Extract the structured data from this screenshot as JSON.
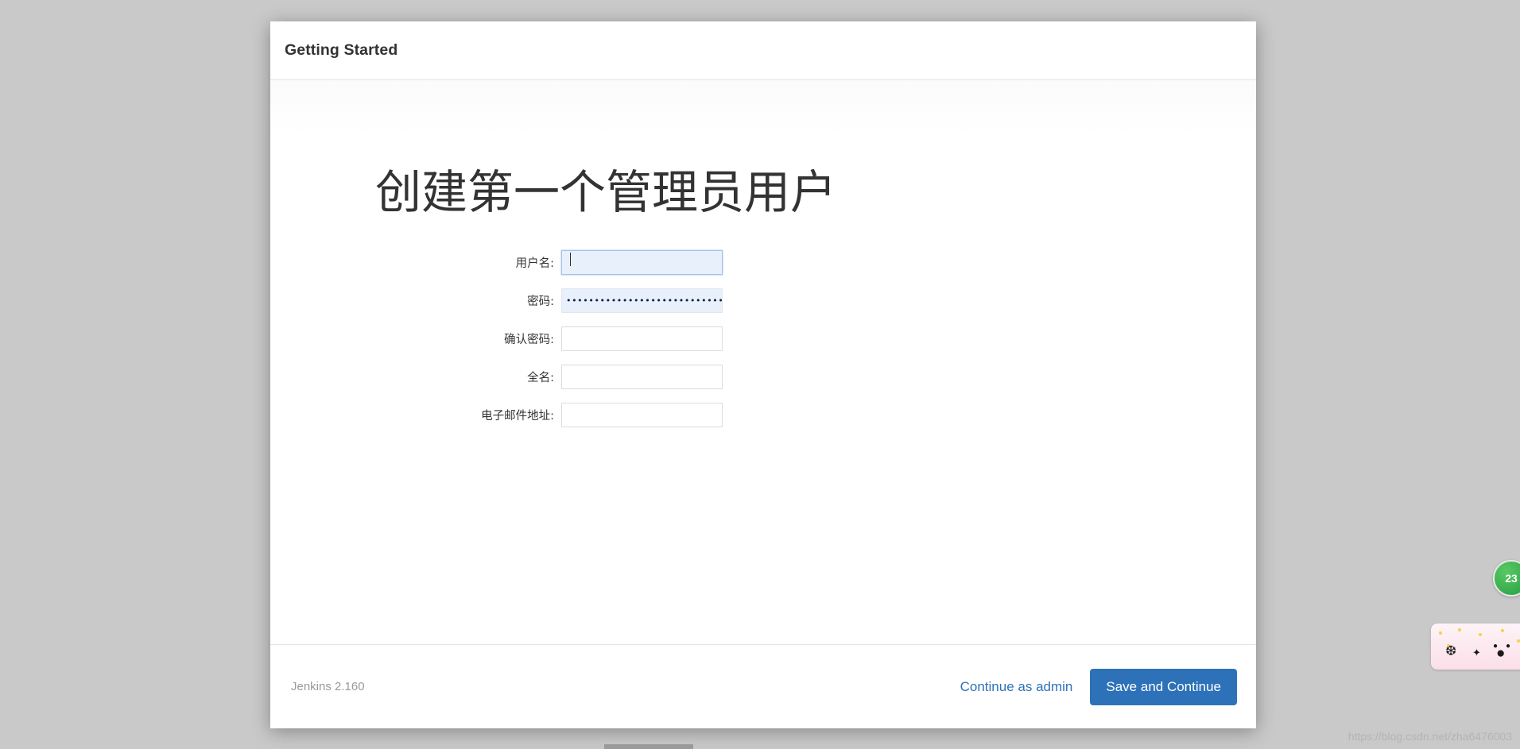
{
  "window": {
    "background_color": "#c9c9c9"
  },
  "dialog": {
    "header_title": "Getting Started",
    "heading": "创建第一个管理员用户",
    "form": {
      "fields": [
        {
          "label": "用户名:",
          "name": "username",
          "type": "text",
          "value": "",
          "state": "focused",
          "placeholder": ""
        },
        {
          "label": "密码:",
          "name": "password",
          "type": "password",
          "value": "••••••••••••••••••••••••••••••••",
          "state": "autofilled",
          "placeholder": ""
        },
        {
          "label": "确认密码:",
          "name": "confirm-password",
          "type": "password",
          "value": "",
          "state": "empty",
          "placeholder": ""
        },
        {
          "label": "全名:",
          "name": "fullname",
          "type": "text",
          "value": "",
          "state": "empty",
          "placeholder": ""
        },
        {
          "label": "电子邮件地址:",
          "name": "email",
          "type": "text",
          "value": "",
          "state": "empty",
          "placeholder": ""
        }
      ]
    },
    "footer": {
      "version": "Jenkins 2.160",
      "continue_as_admin_label": "Continue as admin",
      "save_and_continue_label": "Save and Continue",
      "primary_color": "#2d72b8",
      "link_color": "#2d72b8"
    }
  },
  "widgets": {
    "counter_badge": {
      "value": "23",
      "color": "#34a94a"
    },
    "promo": {
      "name": "promo-sticker"
    }
  },
  "watermark": {
    "text": "https://blog.csdn.net/zha6476003"
  }
}
